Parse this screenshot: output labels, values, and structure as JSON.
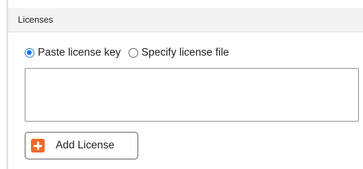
{
  "section": {
    "title": "Licenses"
  },
  "license_source": {
    "options": [
      {
        "label": "Paste license key",
        "selected": true
      },
      {
        "label": "Specify license file",
        "selected": false
      }
    ]
  },
  "license_key_input": {
    "value": ""
  },
  "actions": {
    "add_license_label": "Add License",
    "add_license_icon": "plus-square-icon",
    "icon_color": "#f06a2a"
  },
  "colors": {
    "radio_selected": "#1a73e8",
    "header_background": "#f3f3f3"
  }
}
